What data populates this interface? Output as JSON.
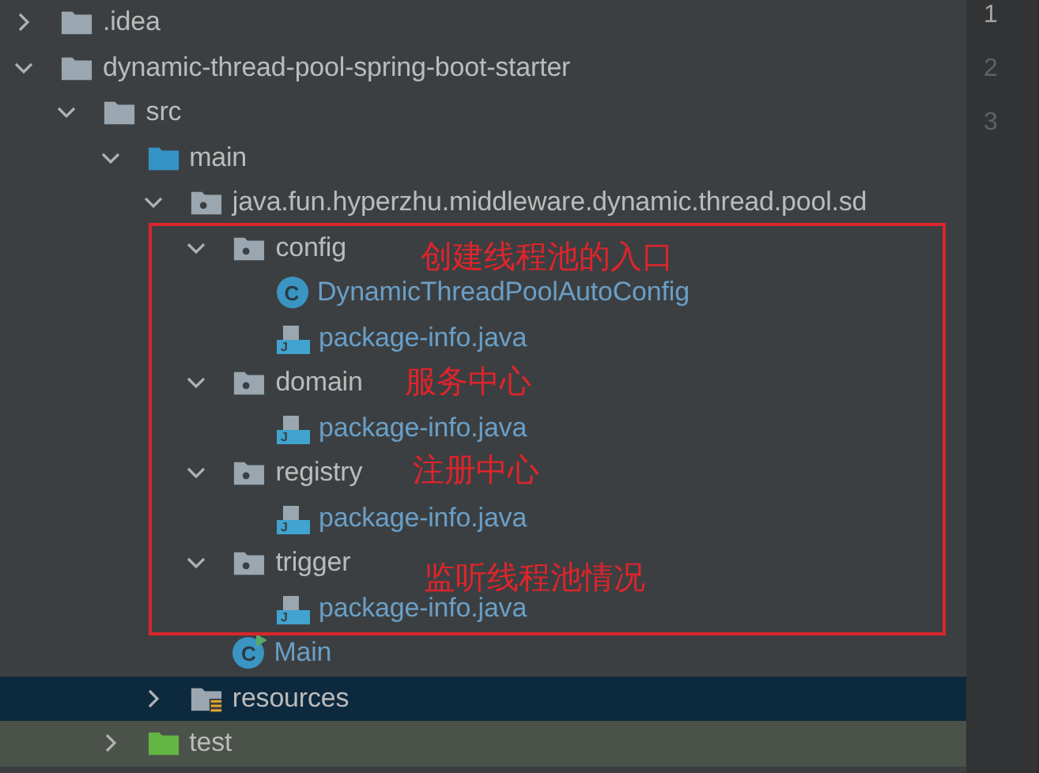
{
  "project_tree": [
    {
      "name": ".idea",
      "kind": "folder",
      "expanded": false,
      "selected": false,
      "highlighted": false
    },
    {
      "name": "dynamic-thread-pool-spring-boot-starter",
      "kind": "folder",
      "expanded": true,
      "selected": false,
      "highlighted": false,
      "children": [
        {
          "name": "src",
          "kind": "folder",
          "expanded": true,
          "selected": false,
          "highlighted": false,
          "children": [
            {
              "name": "main",
              "kind": "source-folder",
              "expanded": true,
              "selected": false,
              "highlighted": false,
              "children": [
                {
                  "name": "java.fun.hyperzhu.middleware.dynamic.thread.pool.sd",
                  "kind": "package",
                  "expanded": true,
                  "selected": false,
                  "highlighted": false,
                  "children": [
                    {
                      "name": "config",
                      "kind": "package",
                      "expanded": true,
                      "selected": false,
                      "highlighted": false,
                      "children": [
                        {
                          "name": "DynamicThreadPoolAutoConfig",
                          "kind": "class",
                          "badge": "C",
                          "selected": false,
                          "highlighted": false
                        },
                        {
                          "name": "package-info.java",
                          "kind": "java-file",
                          "badge": "J",
                          "selected": false,
                          "highlighted": false
                        }
                      ]
                    },
                    {
                      "name": "domain",
                      "kind": "package",
                      "expanded": true,
                      "selected": false,
                      "highlighted": false,
                      "children": [
                        {
                          "name": "package-info.java",
                          "kind": "java-file",
                          "badge": "J",
                          "selected": false,
                          "highlighted": false
                        }
                      ]
                    },
                    {
                      "name": "registry",
                      "kind": "package",
                      "expanded": true,
                      "selected": false,
                      "highlighted": false,
                      "children": [
                        {
                          "name": "package-info.java",
                          "kind": "java-file",
                          "badge": "J",
                          "selected": false,
                          "highlighted": false
                        }
                      ]
                    },
                    {
                      "name": "trigger",
                      "kind": "package",
                      "expanded": true,
                      "selected": false,
                      "highlighted": false,
                      "children": [
                        {
                          "name": "package-info.java",
                          "kind": "java-file",
                          "badge": "J",
                          "selected": false,
                          "highlighted": false
                        }
                      ]
                    },
                    {
                      "name": "Main",
                      "kind": "main-class",
                      "badge": "C",
                      "selected": false,
                      "highlighted": false
                    }
                  ]
                },
                {
                  "name": "resources",
                  "kind": "resources-folder",
                  "expanded": false,
                  "selected": true,
                  "highlighted": false
                }
              ]
            },
            {
              "name": "test",
              "kind": "test-folder",
              "expanded": false,
              "selected": false,
              "highlighted": true
            }
          ]
        }
      ]
    }
  ],
  "annotations": [
    {
      "text": "创建线程池的入口"
    },
    {
      "text": "服务中心"
    },
    {
      "text": "注册中心"
    },
    {
      "text": "监听线程池情况"
    }
  ],
  "editor_gutter": {
    "lines": [
      {
        "number": "1",
        "current": true
      },
      {
        "number": "2",
        "current": false
      },
      {
        "number": "3",
        "current": false
      }
    ]
  }
}
